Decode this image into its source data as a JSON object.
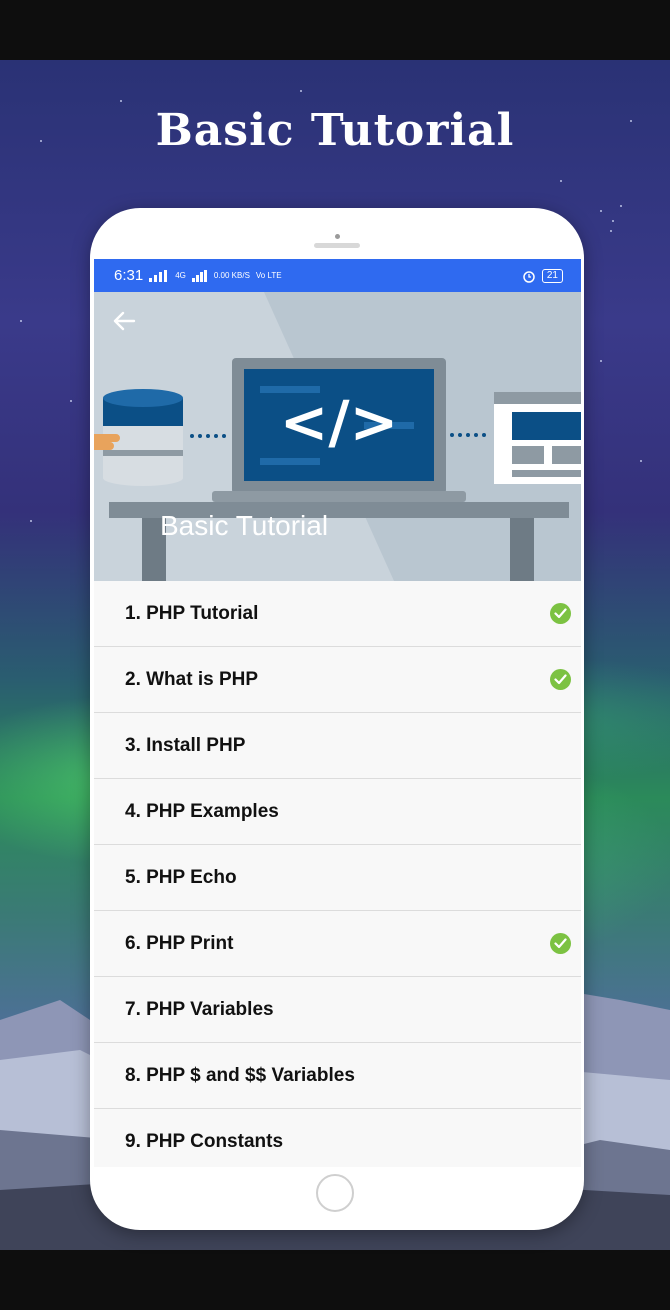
{
  "page_title": "Basic Tutorial",
  "status_bar": {
    "time": "6:31",
    "network": "4G",
    "speed": "0.00 KB/S",
    "volte": "Vo LTE",
    "battery": "21"
  },
  "header": {
    "title": "Basic Tutorial",
    "code_symbol": "</>"
  },
  "lessons": [
    {
      "label": "1. PHP Tutorial",
      "completed": true
    },
    {
      "label": "2. What is PHP",
      "completed": true
    },
    {
      "label": "3. Install PHP",
      "completed": false
    },
    {
      "label": "4. PHP Examples",
      "completed": false
    },
    {
      "label": "5. PHP Echo",
      "completed": false
    },
    {
      "label": "6. PHP Print",
      "completed": true
    },
    {
      "label": "7. PHP Variables",
      "completed": false
    },
    {
      "label": "8. PHP $ and $$ Variables",
      "completed": false
    },
    {
      "label": "9. PHP Constants",
      "completed": false
    }
  ],
  "colors": {
    "status_bar": "#2f6af0",
    "check": "#7cc242",
    "hero_bg": "#c9d3db",
    "screen_blue": "#0b4f86"
  }
}
